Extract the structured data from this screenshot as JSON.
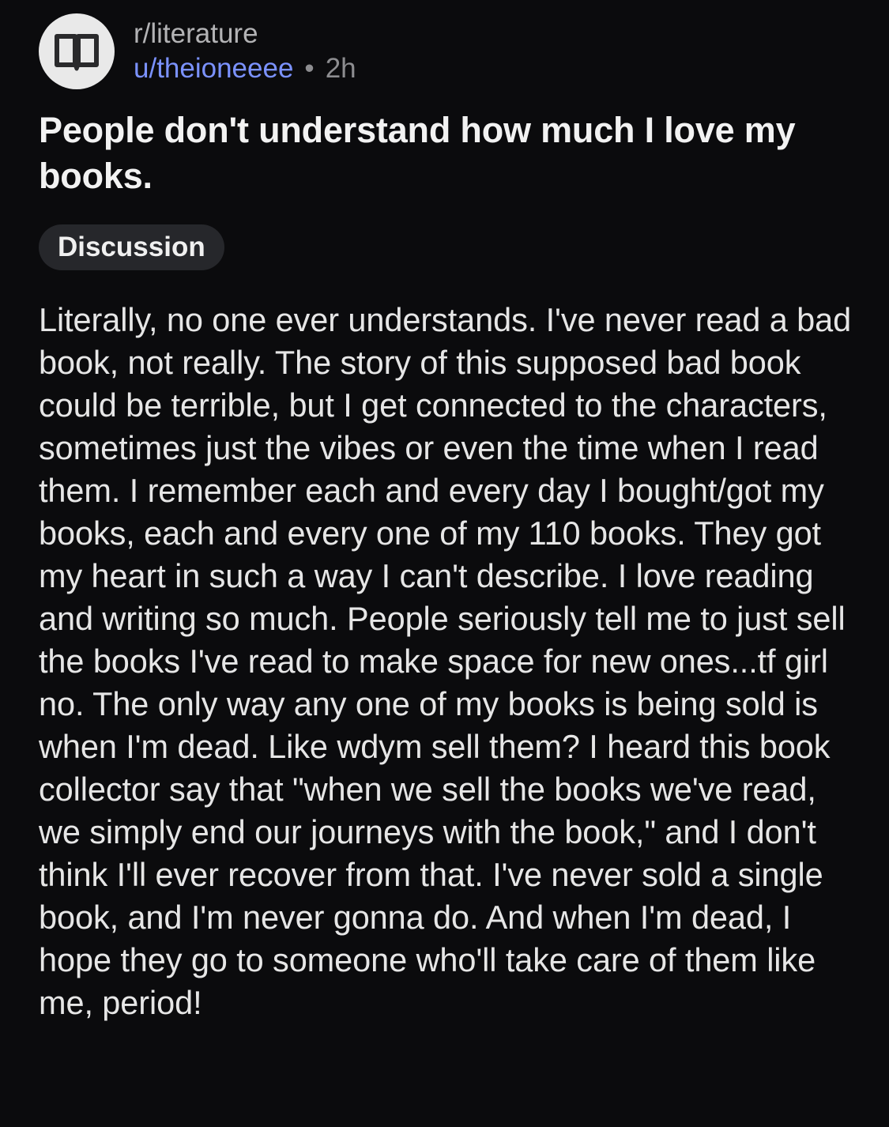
{
  "post": {
    "subreddit": "r/literature",
    "username": "u/theioneeee",
    "separator": "•",
    "age": "2h",
    "avatar_icon": "open-book-icon",
    "title": "People don't understand how much I love my books.",
    "flair": "Discussion",
    "body": "Literally, no one ever understands. I've never read a bad book, not really. The story of this supposed bad book could be terrible, but I get connected to the characters, sometimes just the vibes or even the time when I read them. I remember each and every day I bought/got my books, each and every one of my 110 books. They got my heart in such a way I can't describe. I love reading and writing so much. People seriously tell me to just sell the books I've read to make space for new ones...tf girl no. The only way any one of my books is being sold is when I'm dead. Like wdym sell them? I heard this book collector say that \"when we sell the books we've read, we simply end our journeys with the book,\" and I don't think I'll ever recover from that. I've never sold a single book, and I'm never gonna do. And when I'm dead, I hope they go to someone who'll take care of them like me, period!"
  },
  "colors": {
    "background": "#0b0b0d",
    "username": "#7b92ff",
    "flair_bg": "#26272b",
    "avatar_bg": "#e9e9e9"
  }
}
